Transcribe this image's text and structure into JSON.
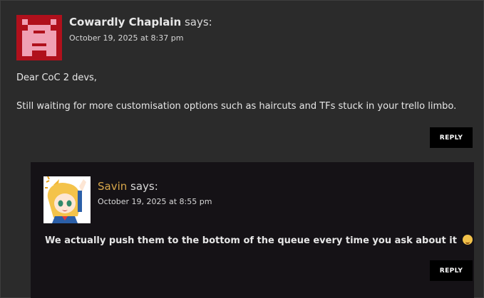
{
  "comment": {
    "author": "Cowardly Chaplain",
    "says": "says:",
    "date": "October 19, 2025 at 8:37 pm",
    "paragraphs": [
      "Dear CoC 2 devs,",
      "Still waiting for more customisation options such as haircuts and TFs stuck in your trello limbo."
    ],
    "reply_label": "REPLY",
    "avatar_color": "#b0101c"
  },
  "reply": {
    "author": "Savin",
    "says": "says:",
    "date": "October 19, 2025 at 8:55 pm",
    "text": "We actually push them to the bottom of the queue every time you ask about it",
    "emoji": "wink-smile-emoji",
    "reply_label": "REPLY",
    "author_color": "#d7a64a"
  }
}
